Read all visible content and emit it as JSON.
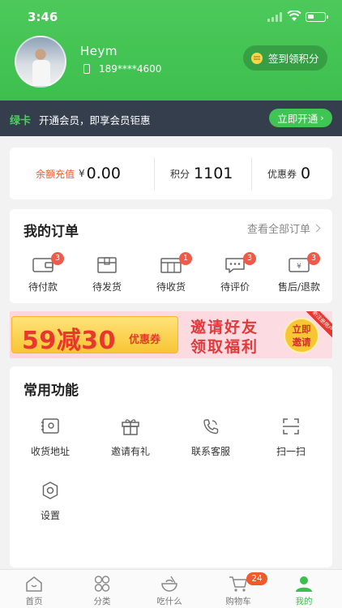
{
  "status_bar": {
    "time": "3:46"
  },
  "profile": {
    "name": "Heym",
    "phone": "189****4600",
    "checkin_label": "签到领积分"
  },
  "member_bar": {
    "tag": "绿卡",
    "text": "开通会员，即享会员钜惠",
    "button": "立即开通"
  },
  "stats": [
    {
      "label": "余额充值",
      "prefix": "¥",
      "value": "0.00",
      "label_color": "#f05a2c"
    },
    {
      "label": "积分",
      "value": "1101"
    },
    {
      "label": "优惠券",
      "value": "0"
    }
  ],
  "orders": {
    "title": "我的订单",
    "view_all": "查看全部订单",
    "items": [
      {
        "label": "待付款",
        "badge": "3",
        "icon": "wallet-icon"
      },
      {
        "label": "待发货",
        "badge": "",
        "icon": "package-icon"
      },
      {
        "label": "待收货",
        "badge": "1",
        "icon": "truck-box-icon"
      },
      {
        "label": "待评价",
        "badge": "3",
        "icon": "comment-icon"
      },
      {
        "label": "售后/退款",
        "badge": "3",
        "icon": "refund-icon"
      }
    ]
  },
  "banner": {
    "big_text": "59减30",
    "coupon_text": "优惠券",
    "line1": "邀请好友",
    "line2": "领取福利",
    "button_line1": "立即",
    "button_line2": "邀请",
    "corner": "新注册用户"
  },
  "functions": {
    "title": "常用功能",
    "items": [
      {
        "label": "收货地址",
        "icon": "address-icon"
      },
      {
        "label": "邀请有礼",
        "icon": "gift-icon"
      },
      {
        "label": "联系客服",
        "icon": "phone-service-icon"
      },
      {
        "label": "扫一扫",
        "icon": "scan-icon"
      },
      {
        "label": "设置",
        "icon": "settings-icon"
      }
    ]
  },
  "tabbar": {
    "items": [
      {
        "label": "首页",
        "icon": "home-icon"
      },
      {
        "label": "分类",
        "icon": "category-icon"
      },
      {
        "label": "吃什么",
        "icon": "bowl-icon"
      },
      {
        "label": "购物车",
        "icon": "cart-icon",
        "badge": "24"
      },
      {
        "label": "我的",
        "icon": "user-icon",
        "active": true
      }
    ]
  },
  "colors": {
    "brand_green": "#3dbf4e",
    "dark_bar": "#343e4d",
    "badge_red": "#f05a4a"
  }
}
